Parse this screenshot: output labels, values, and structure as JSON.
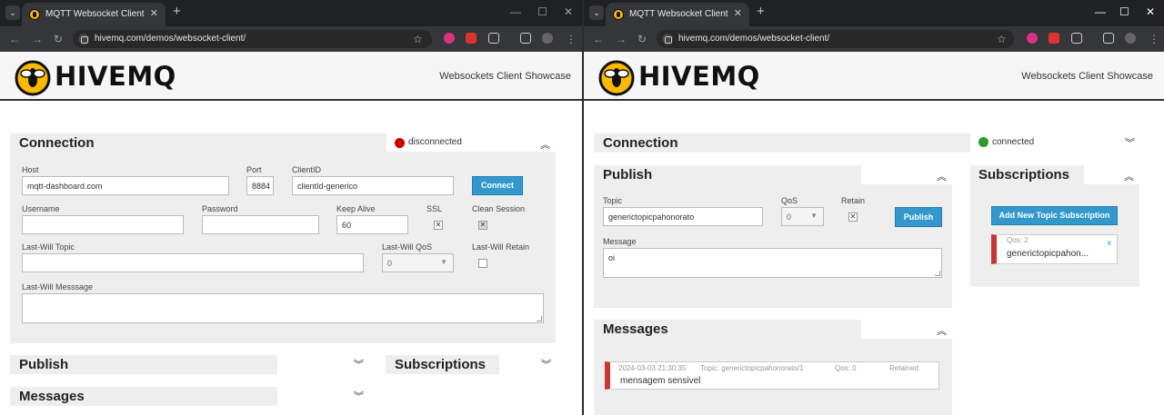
{
  "browser": {
    "tab_title": "MQTT Websocket Client",
    "url": "hivemq.com/demos/websocket-client/",
    "icons": {
      "menu": "tab-search-icon",
      "close": "close-icon",
      "new_tab": "plus-icon",
      "back": "arrow-left-icon",
      "forward": "arrow-right-icon",
      "reload": "reload-icon",
      "site_settings": "site-settings-icon",
      "bookmark": "star-icon",
      "minimize": "minimize-icon",
      "maximize": "maximize-icon",
      "window_close": "window-close-icon"
    }
  },
  "header": {
    "brand": "HIVEMQ",
    "tagline": "Websockets Client Showcase"
  },
  "left": {
    "connection": {
      "title": "Connection",
      "status": "disconnected",
      "status_color": "#cc0000",
      "host_label": "Host",
      "host_value": "mqtt-dashboard.com",
      "port_label": "Port",
      "port_value": "8884",
      "clientid_label": "ClientID",
      "clientid_value": "clientId-generico",
      "connect_label": "Connect",
      "username_label": "Username",
      "password_label": "Password",
      "keepalive_label": "Keep Alive",
      "keepalive_value": "60",
      "ssl_label": "SSL",
      "clean_label": "Clean Session",
      "lwt_topic_label": "Last-Will Topic",
      "lwt_qos_label": "Last-Will QoS",
      "lwt_qos_value": "0",
      "lwt_retain_label": "Last-Will Retain",
      "lwt_msg_label": "Last-Will Messsage"
    },
    "publish_title": "Publish",
    "subscriptions_title": "Subscriptions",
    "messages_title": "Messages"
  },
  "right": {
    "connection": {
      "title": "Connection",
      "status": "connected",
      "status_color": "#2a9d2a"
    },
    "publish": {
      "title": "Publish",
      "topic_label": "Topic",
      "topic_value": "generictopicpahonorato",
      "qos_label": "QoS",
      "qos_value": "0",
      "retain_label": "Retain",
      "publish_label": "Publish",
      "message_label": "Message",
      "message_value": "oi"
    },
    "subscriptions": {
      "title": "Subscriptions",
      "add_label": "Add New Topic Subscription",
      "items": [
        {
          "qos": "Qos: 2",
          "topic": "generictopicpahon...",
          "remove": "x",
          "color": "#cc3333"
        }
      ]
    },
    "messages": {
      "title": "Messages",
      "items": [
        {
          "timestamp": "2024-03-03 21:30:35",
          "topic": "Topic: generictopicpahonorato/1",
          "qos": "Qos: 0",
          "retained": "Retained",
          "text": "mensagem sensivel",
          "color": "#cc3333"
        }
      ]
    }
  }
}
